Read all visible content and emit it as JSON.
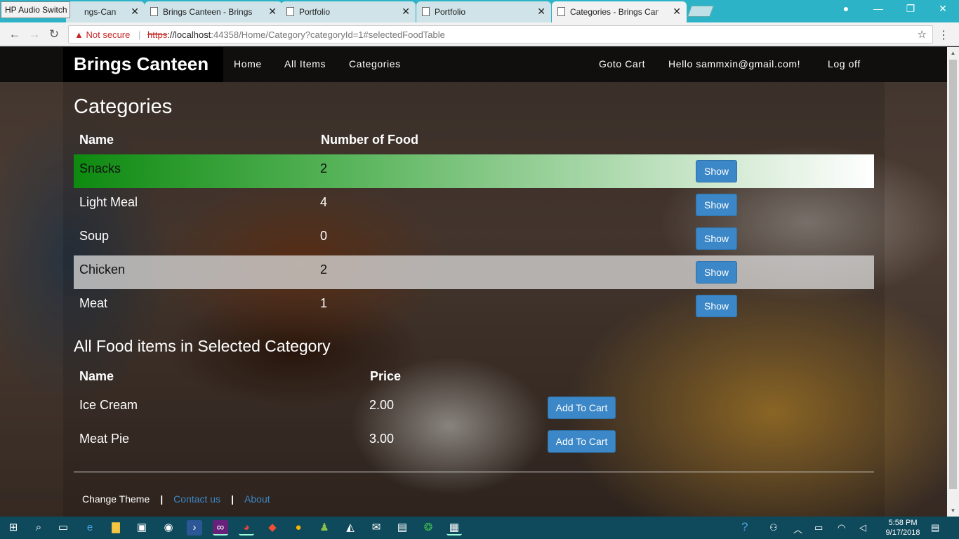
{
  "browser": {
    "overlay_app": "HP Audio Switch",
    "tabs": [
      {
        "label": "ngs-Canteen: I",
        "active": false
      },
      {
        "label": "Brings Canteen - Brings C",
        "active": false
      },
      {
        "label": "Portfolio",
        "active": false
      },
      {
        "label": "Portfolio",
        "active": false
      },
      {
        "label": "Categories - Brings Cante",
        "active": true
      }
    ],
    "security_label": "Not secure",
    "url": {
      "scheme": "https",
      "host": "://localhost",
      "rest": ":44358/Home/Category?categoryId=1#selectedFoodTable"
    }
  },
  "site": {
    "brand": "Brings Canteen",
    "nav": {
      "home": "Home",
      "all_items": "All Items",
      "categories": "Categories"
    },
    "nav_right": {
      "cart": "Goto Cart",
      "greeting": "Hello sammxin@gmail.com!",
      "logoff": "Log off"
    }
  },
  "categories": {
    "title": "Categories",
    "headers": {
      "name": "Name",
      "count": "Number of Food"
    },
    "button_label": "Show",
    "rows": [
      {
        "name": "Snacks",
        "count": "2"
      },
      {
        "name": "Light Meal",
        "count": "4"
      },
      {
        "name": "Soup",
        "count": "0"
      },
      {
        "name": "Chicken",
        "count": "2"
      },
      {
        "name": "Meat",
        "count": "1"
      }
    ]
  },
  "food": {
    "title": "All Food items in Selected Category",
    "headers": {
      "name": "Name",
      "price": "Price"
    },
    "button_label": "Add To Cart",
    "rows": [
      {
        "name": "Ice Cream",
        "price": "2.00"
      },
      {
        "name": "Meat Pie",
        "price": "3.00"
      }
    ]
  },
  "footer": {
    "theme": "Change Theme",
    "contact": "Contact us",
    "about": "About"
  },
  "taskbar": {
    "time": "5:58 PM",
    "date": "9/17/2018"
  },
  "colors": {
    "accent": "#3b87c7",
    "selected_row": "#0e8a10",
    "navbar": "#0c0c0c",
    "taskbar": "#0f4a5c"
  }
}
